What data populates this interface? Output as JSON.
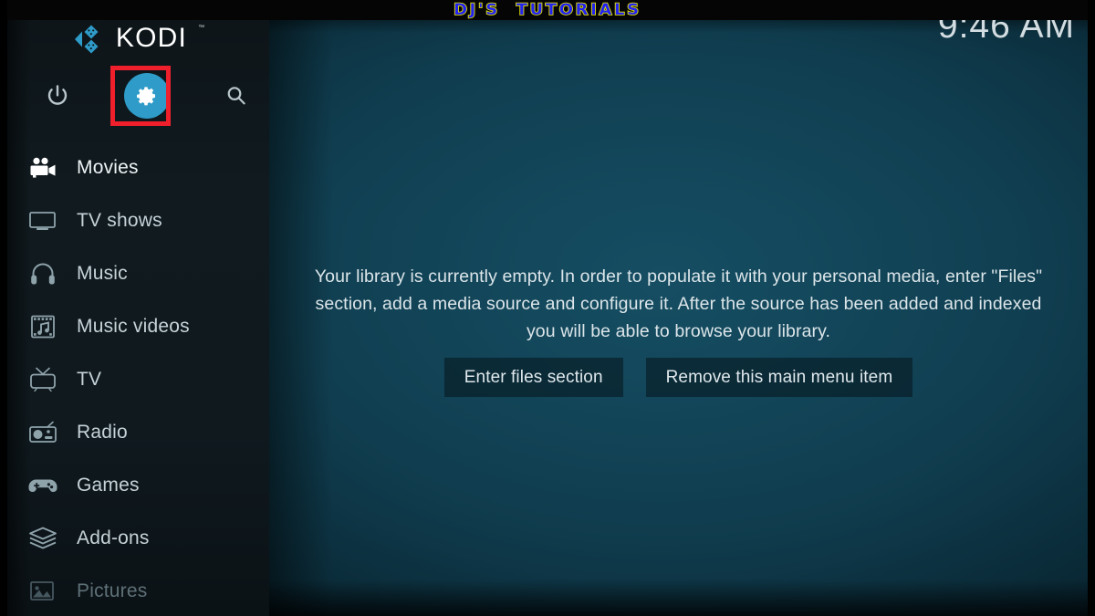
{
  "app": {
    "name": "KODI",
    "trademark": "™"
  },
  "banner": {
    "text": "DJ'S  TUTORIALS",
    "text_color": "#2323ef",
    "outline_color": "#eded00",
    "background": "#050505"
  },
  "clock": {
    "time": "9:46 AM"
  },
  "sidebar": {
    "top_icons": [
      {
        "name": "power-button",
        "icon": "power-icon",
        "label": "Power"
      },
      {
        "name": "settings-button",
        "icon": "gear-icon",
        "label": "Settings",
        "highlighted": true,
        "circle_color": "#2e9bc8"
      },
      {
        "name": "search-button",
        "icon": "search-icon",
        "label": "Search"
      }
    ],
    "highlight": {
      "target": "settings-button",
      "color": "#ef1f2c",
      "shape": "rectangle-outline"
    },
    "items": [
      {
        "label": "Movies",
        "icon": "movie-camera-icon",
        "state": "selected"
      },
      {
        "label": "TV shows",
        "icon": "television-icon",
        "state": "normal"
      },
      {
        "label": "Music",
        "icon": "headphones-icon",
        "state": "normal"
      },
      {
        "label": "Music videos",
        "icon": "film-music-icon",
        "state": "normal"
      },
      {
        "label": "TV",
        "icon": "tv-antenna-icon",
        "state": "normal"
      },
      {
        "label": "Radio",
        "icon": "radio-icon",
        "state": "normal"
      },
      {
        "label": "Games",
        "icon": "gamepad-icon",
        "state": "normal"
      },
      {
        "label": "Add-ons",
        "icon": "addon-box-icon",
        "state": "normal"
      },
      {
        "label": "Pictures",
        "icon": "picture-icon",
        "state": "dim"
      }
    ]
  },
  "main": {
    "message": "Your library is currently empty. In order to populate it with your personal media, enter \"Files\" section, add a media source and configure it. After the source has been added and indexed you will be able to browse your library.",
    "buttons": [
      {
        "label": "Enter files section"
      },
      {
        "label": "Remove this main menu item"
      }
    ]
  },
  "theme": {
    "accent": "#2e9bc8",
    "panel_teal": "#11495e",
    "sidebar_dark": "#101a1f",
    "text_primary": "#dbe5e9",
    "text_dim": "#5e7077"
  }
}
